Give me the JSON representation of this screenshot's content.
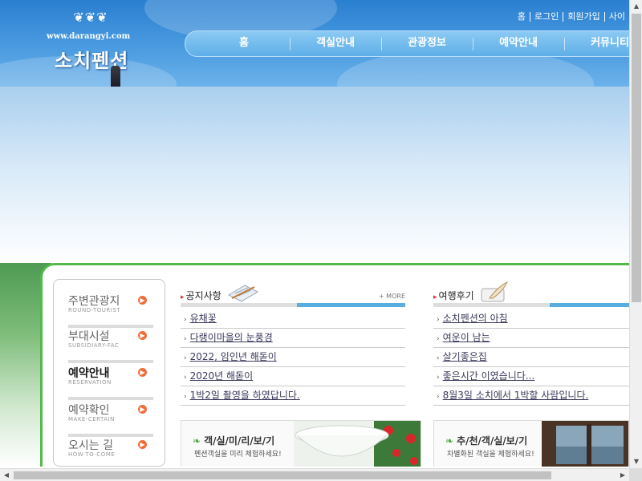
{
  "logo": {
    "url": "www.darangyi.com",
    "name": "소치펜션"
  },
  "toplinks": [
    "홈",
    "로그인",
    "회원가입",
    "사이"
  ],
  "gnb": [
    "홈",
    "객실안내",
    "관광정보",
    "예약안내",
    "커뮤니티"
  ],
  "leftmenu": [
    {
      "ko": "주변관광지",
      "en": "ROUND-TOURIST"
    },
    {
      "ko": "부대시설",
      "en": "SUBSIDIARY-FAC"
    },
    {
      "ko": "예약안내",
      "en": "RESERVATION"
    },
    {
      "ko": "예약확인",
      "en": "MAKE-CERTAIN"
    },
    {
      "ko": "오시는 길",
      "en": "HOW-TO-COME"
    }
  ],
  "notice": {
    "title": "공지사항",
    "more": "+ MORE",
    "items": [
      "유채꽃",
      "다랭이마을의 눈풍경",
      "2022, 임인년 해돋이",
      "2020년 해돋이",
      "1박2일 촬영을 하였답니다."
    ]
  },
  "review": {
    "title": "여행후기",
    "items": [
      "소치펜션의 아침",
      "여운이 남는",
      "살기좋은집",
      "좋은시간 이였습니다...",
      "8월3일 소치에서 1박할 사람입니다."
    ]
  },
  "promos": [
    {
      "title": "객/실/미/리/보/기",
      "subtitle": "펜션객실을 미리 체험하세요!"
    },
    {
      "title": "추/천/객/실/보/기",
      "subtitle": "차별화된 객실을 체험하세요!"
    }
  ],
  "colors": {
    "header_top": "#2a7fd0",
    "green_accent": "#52b94a",
    "board_highlight": "#58aee0",
    "arrow": "#f06d3b"
  }
}
